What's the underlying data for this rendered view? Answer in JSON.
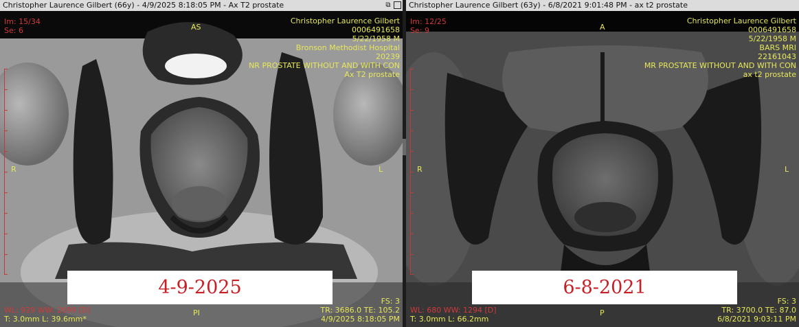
{
  "left": {
    "title": "Christopher Laurence Gilbert (66y) - 4/9/2025 8:18:05 PM - Ax T2 prostate",
    "image_info": [
      "Im: 15/34",
      "Se: 6"
    ],
    "patient_info": [
      "Christopher Laurence Gilbert",
      "0006491658",
      "5/22/1958 M",
      "Bronson Methodist Hospital",
      "20239",
      "NR PROSTATE WITHOUT AND WITH CON",
      "Ax T2 prostate"
    ],
    "orient_top": "AS",
    "orient_left": "R",
    "orient_right": "L",
    "orient_bottom": "PI",
    "window": "WL: 929 WW: 2099 [D]",
    "thickness": "T: 3.0mm L: 39.6mm*",
    "fs": "FS: 3",
    "tr_te": "TR: 3686.0 TE: 105.2",
    "datetime": "4/9/2025 8:18:05 PM",
    "date_label": "4-9-2025"
  },
  "right": {
    "title": "Christopher Laurence Gilbert (63y) - 6/8/2021 9:01:48 PM - ax t2 prostate",
    "image_info": [
      "Im: 12/25",
      "Se: 9"
    ],
    "patient_info": [
      "Christopher Laurence Gilbert",
      "0006491658",
      "5/22/1958 M",
      "BARS MRI",
      "22161043",
      "MR PROSTATE WITHOUT AND WITH CON",
      "ax t2 prostate"
    ],
    "orient_top": "A",
    "orient_left": "R",
    "orient_right": "L",
    "orient_bottom": "P",
    "window": "WL: 680 WW: 1294 [D]",
    "thickness": "T: 3.0mm L: 66.2mm",
    "fs": "FS: 3",
    "tr_te": "TR: 3700.0 TE: 87.0",
    "datetime": "6/8/2021 9:03:11 PM",
    "date_label": "6-8-2021"
  },
  "colors": {
    "overlay_text": "#e8e85a",
    "overlay_red": "#d23a3a",
    "date_label_text": "#c61f26",
    "titlebar_bg": "#dcdcdc"
  },
  "icons": [
    "window-restore-icon",
    "window-maximize-icon"
  ]
}
